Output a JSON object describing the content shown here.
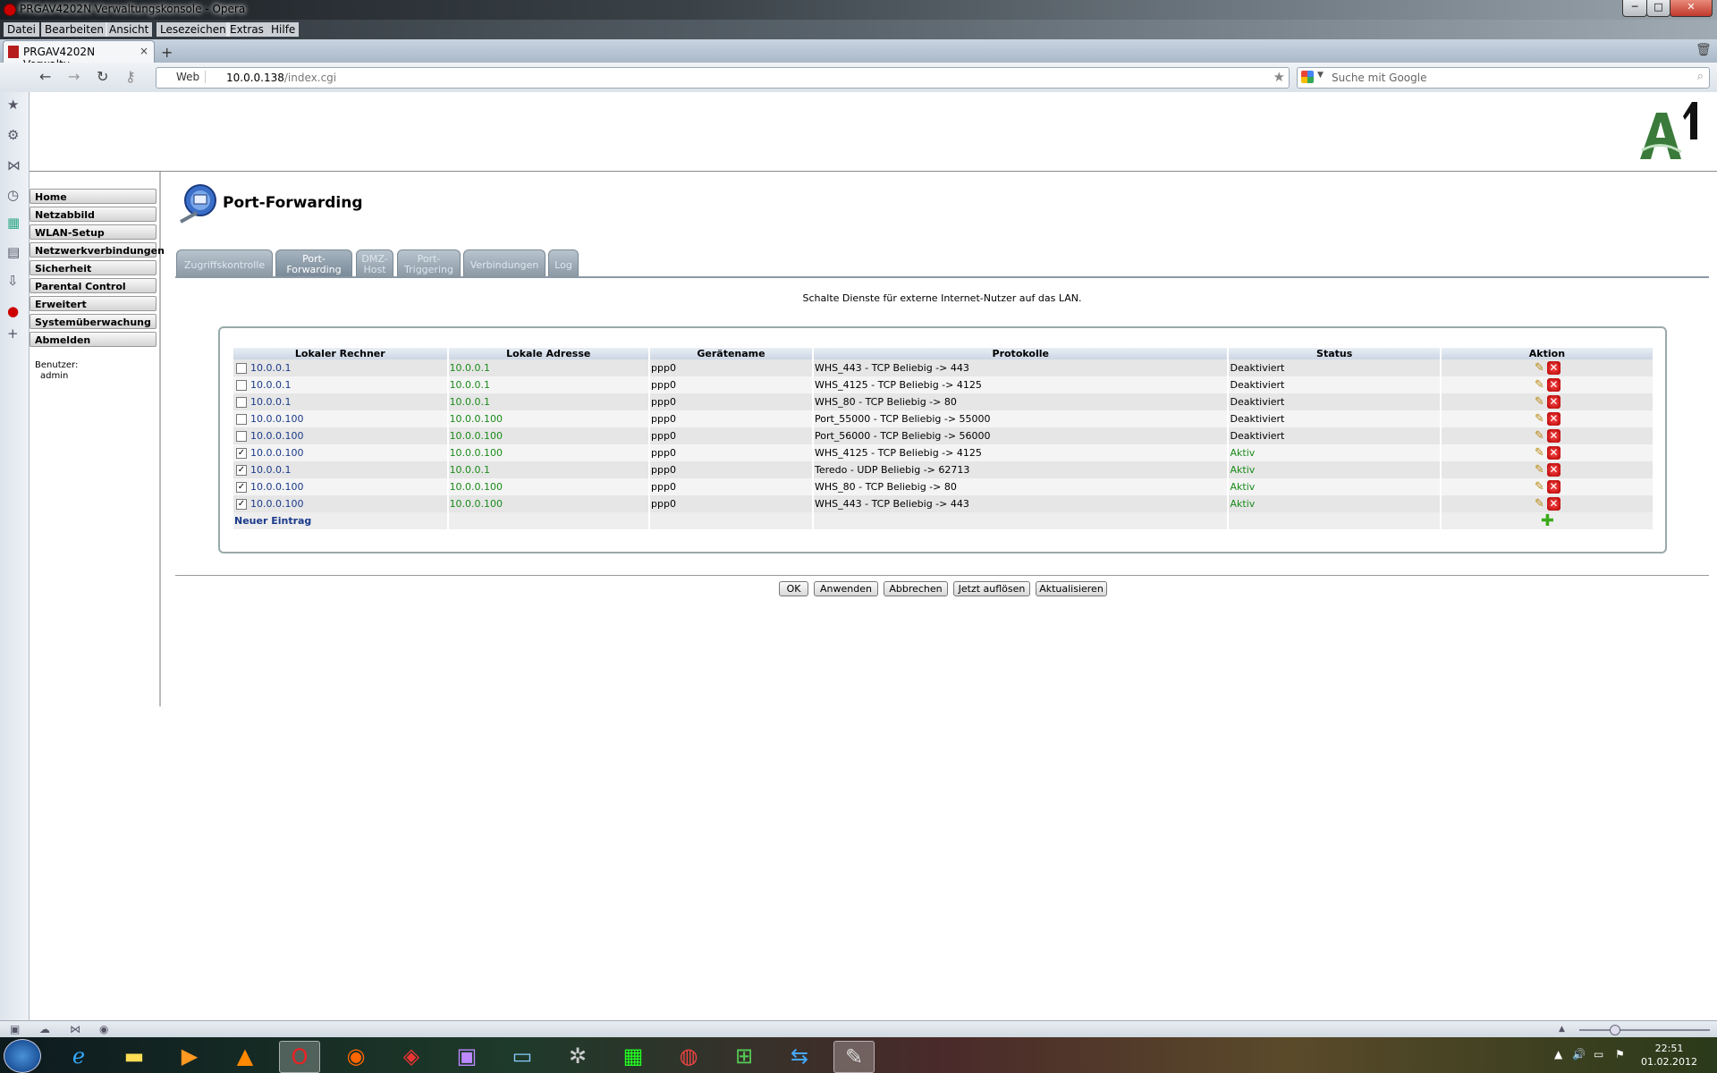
{
  "window": {
    "title": "PRGAV4202N Verwaltungskonsole - Opera",
    "minimize": "─",
    "maximize": "□",
    "close": "✕"
  },
  "menu": [
    "Datei",
    "Bearbeiten",
    "Ansicht",
    "Lesezeichen",
    "Extras",
    "Hilfe"
  ],
  "tab": {
    "label": "PRGAV4202N Verwaltu...",
    "close": "×",
    "new_tab": "+"
  },
  "address": {
    "mode": "Web",
    "url_host": "10.0.0.138",
    "url_path": "/index.cgi",
    "search_placeholder": "Suche mit Google"
  },
  "nav": [
    "Home",
    "Netzabbild",
    "WLAN-Setup",
    "Netzwerkverbindungen",
    "Sicherheit",
    "Parental Control",
    "Erweitert",
    "Systemüberwachung",
    "Abmelden"
  ],
  "user": {
    "label": "Benutzer:",
    "name": "admin"
  },
  "page": {
    "title": "Port-Forwarding",
    "description": "Schalte Dienste für externe Internet-Nutzer auf das LAN."
  },
  "tabs": [
    {
      "lines": [
        "Zugriffskontrolle"
      ],
      "active": false
    },
    {
      "lines": [
        "Port-",
        "Forwarding"
      ],
      "active": true
    },
    {
      "lines": [
        "DMZ-",
        "Host"
      ],
      "active": false
    },
    {
      "lines": [
        "Port-",
        "Triggering"
      ],
      "active": false
    },
    {
      "lines": [
        "Verbindungen"
      ],
      "active": false
    },
    {
      "lines": [
        "Log"
      ],
      "active": false
    }
  ],
  "table": {
    "headers": [
      "Lokaler Rechner",
      "Lokale Adresse",
      "Gerätename",
      "Protokolle",
      "Status",
      "Aktion"
    ],
    "rows": [
      {
        "checked": false,
        "rechner": "10.0.0.1",
        "adresse": "10.0.0.1",
        "geraet": "ppp0",
        "protokoll": "WHS_443 - TCP Beliebig -> 443",
        "status": "Deaktiviert"
      },
      {
        "checked": false,
        "rechner": "10.0.0.1",
        "adresse": "10.0.0.1",
        "geraet": "ppp0",
        "protokoll": "WHS_4125 - TCP Beliebig -> 4125",
        "status": "Deaktiviert"
      },
      {
        "checked": false,
        "rechner": "10.0.0.1",
        "adresse": "10.0.0.1",
        "geraet": "ppp0",
        "protokoll": "WHS_80 - TCP Beliebig -> 80",
        "status": "Deaktiviert"
      },
      {
        "checked": false,
        "rechner": "10.0.0.100",
        "adresse": "10.0.0.100",
        "geraet": "ppp0",
        "protokoll": "Port_55000 - TCP Beliebig -> 55000",
        "status": "Deaktiviert"
      },
      {
        "checked": false,
        "rechner": "10.0.0.100",
        "adresse": "10.0.0.100",
        "geraet": "ppp0",
        "protokoll": "Port_56000 - TCP Beliebig -> 56000",
        "status": "Deaktiviert"
      },
      {
        "checked": true,
        "rechner": "10.0.0.100",
        "adresse": "10.0.0.100",
        "geraet": "ppp0",
        "protokoll": "WHS_4125 - TCP Beliebig -> 4125",
        "status": "Aktiv"
      },
      {
        "checked": true,
        "rechner": "10.0.0.1",
        "adresse": "10.0.0.1",
        "geraet": "ppp0",
        "protokoll": "Teredo - UDP Beliebig -> 62713",
        "status": "Aktiv"
      },
      {
        "checked": true,
        "rechner": "10.0.0.100",
        "adresse": "10.0.0.100",
        "geraet": "ppp0",
        "protokoll": "WHS_80 - TCP Beliebig -> 80",
        "status": "Aktiv"
      },
      {
        "checked": true,
        "rechner": "10.0.0.100",
        "adresse": "10.0.0.100",
        "geraet": "ppp0",
        "protokoll": "WHS_443 - TCP Beliebig -> 443",
        "status": "Aktiv"
      }
    ],
    "new_entry": "Neuer Eintrag"
  },
  "buttons": {
    "ok": "OK",
    "apply": "Anwenden",
    "cancel": "Abbrechen",
    "resolve": "Jetzt auflösen",
    "refresh": "Aktualisieren"
  },
  "clock": {
    "time": "22:51",
    "date": "01.02.2012"
  },
  "colors": {
    "link": "#1a3a8a",
    "active_status": "#1a8a1a",
    "delete": "#cc0000",
    "add": "#3aaa1a"
  },
  "icons": {
    "sidebar": [
      "star-icon",
      "gear-icon",
      "share-icon",
      "history-icon",
      "widgets-icon",
      "notes-icon",
      "download-icon",
      "opera-unite-icon",
      "add-panel-icon"
    ],
    "row_actions": [
      "pencil-icon",
      "delete-icon"
    ],
    "new_entry_action": "add-icon"
  }
}
